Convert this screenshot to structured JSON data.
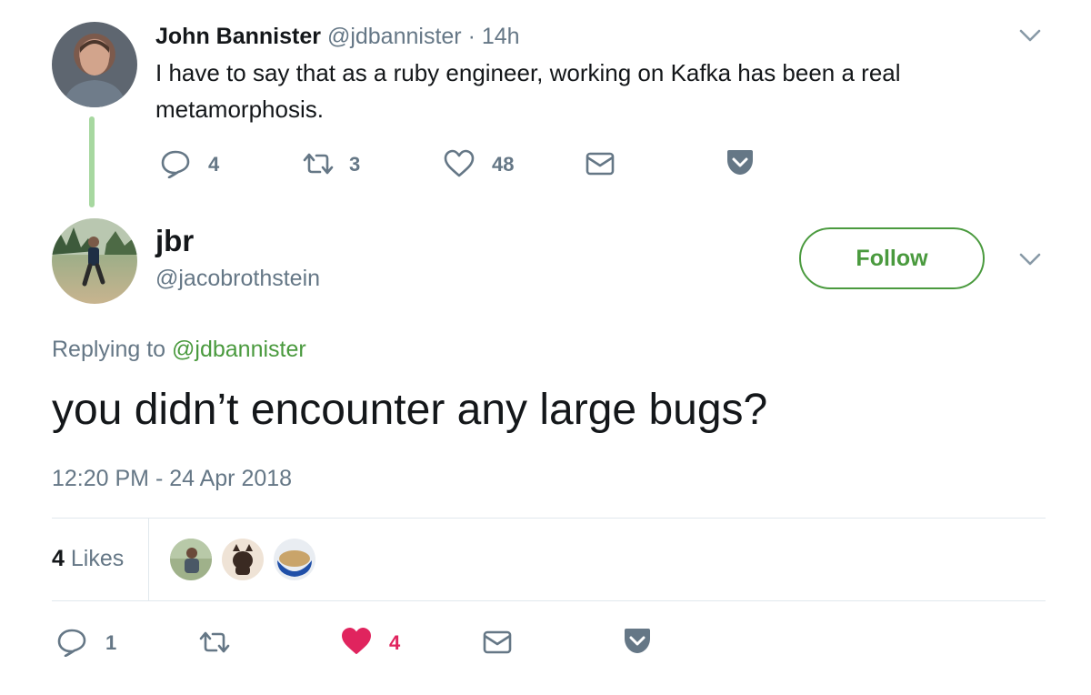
{
  "parent_tweet": {
    "author_name": "John Bannister",
    "handle": "@jdbannister",
    "separator": "·",
    "time": "14h",
    "text": "I have to say that as a ruby engineer, working on Kafka has been a real metamorphosis.",
    "actions": {
      "reply_count": "4",
      "retweet_count": "3",
      "like_count": "48"
    }
  },
  "main_tweet": {
    "author_name": "jbr",
    "handle": "@jacobrothstein",
    "follow_label": "Follow",
    "replying_prefix": "Replying to",
    "replying_to": "@jdbannister",
    "text": "you didn’t encounter any large bugs?",
    "timestamp": "12:20 PM - 24 Apr 2018",
    "likes_count": "4",
    "likes_label": "Likes",
    "actions": {
      "reply_count": "1",
      "retweet_count": "",
      "like_count": "4"
    }
  },
  "colors": {
    "accent_green": "#4a9a3e",
    "like_red": "#e0245e",
    "thread_line": "#a7d8a0",
    "muted_text": "#657786",
    "icon_gray": "#657786"
  },
  "icons": [
    "chevron-down-icon",
    "reply-icon",
    "retweet-icon",
    "heart-icon",
    "mail-icon",
    "pocket-icon"
  ]
}
